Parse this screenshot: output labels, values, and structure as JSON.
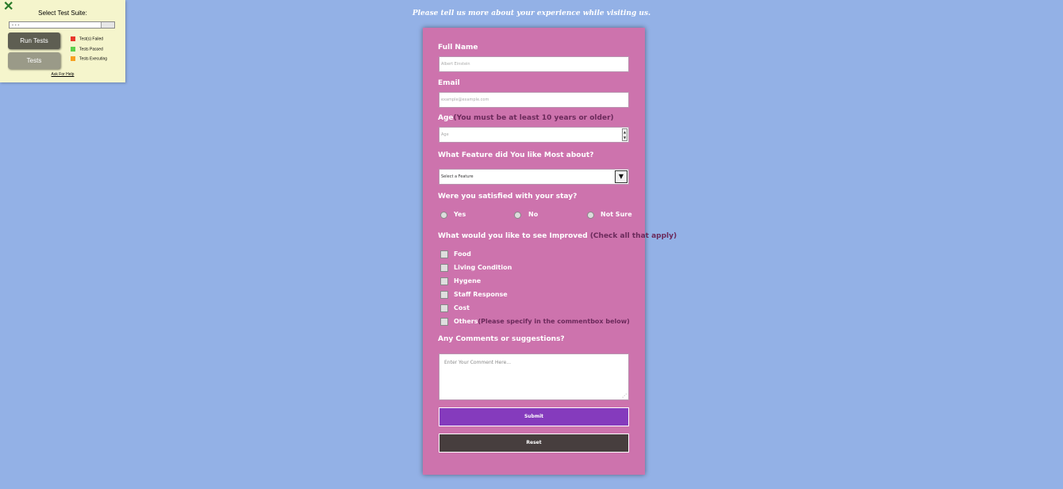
{
  "test_panel": {
    "close_glyph": "✕",
    "title": "Select Test Suite:",
    "select_value": "- - -",
    "run_button": "Run Tests",
    "tests_button": "Tests",
    "legend": [
      {
        "label": "Test(s) Failed",
        "color": "#e8372b"
      },
      {
        "label": "Tests Passed",
        "color": "#5bd04a"
      },
      {
        "label": "Tests Executing",
        "color": "#f7a020"
      }
    ],
    "help_link": "Ask For Help"
  },
  "header": {
    "tagline": "Please tell us more about your experience while visiting us."
  },
  "form": {
    "full_name": {
      "label": "Full Name",
      "placeholder": "Albert Einstein"
    },
    "email": {
      "label": "Email",
      "placeholder": "example@example.com"
    },
    "age": {
      "label": "Age",
      "hint": "(You must be at least 10 years or older)",
      "placeholder": "Age"
    },
    "feature": {
      "label": "What Feature did You like Most about?",
      "selected": "Select a Feature"
    },
    "satisfied": {
      "label": "Were you satisfied with your stay?",
      "options": [
        "Yes",
        "No",
        "Not Sure"
      ]
    },
    "improved": {
      "label": "What would you like to see Improved",
      "hint": "(Check all that apply)",
      "options": [
        "Food",
        "Living Condition",
        "Hygene",
        "Staff Response",
        "Cost",
        "Others"
      ],
      "others_hint": "(Please specify in the commentbox below)"
    },
    "comments": {
      "label": "Any Comments or suggestions?",
      "placeholder": "Enter Your Comment Here..."
    },
    "submit_label": "Submit",
    "reset_label": "Reset"
  }
}
